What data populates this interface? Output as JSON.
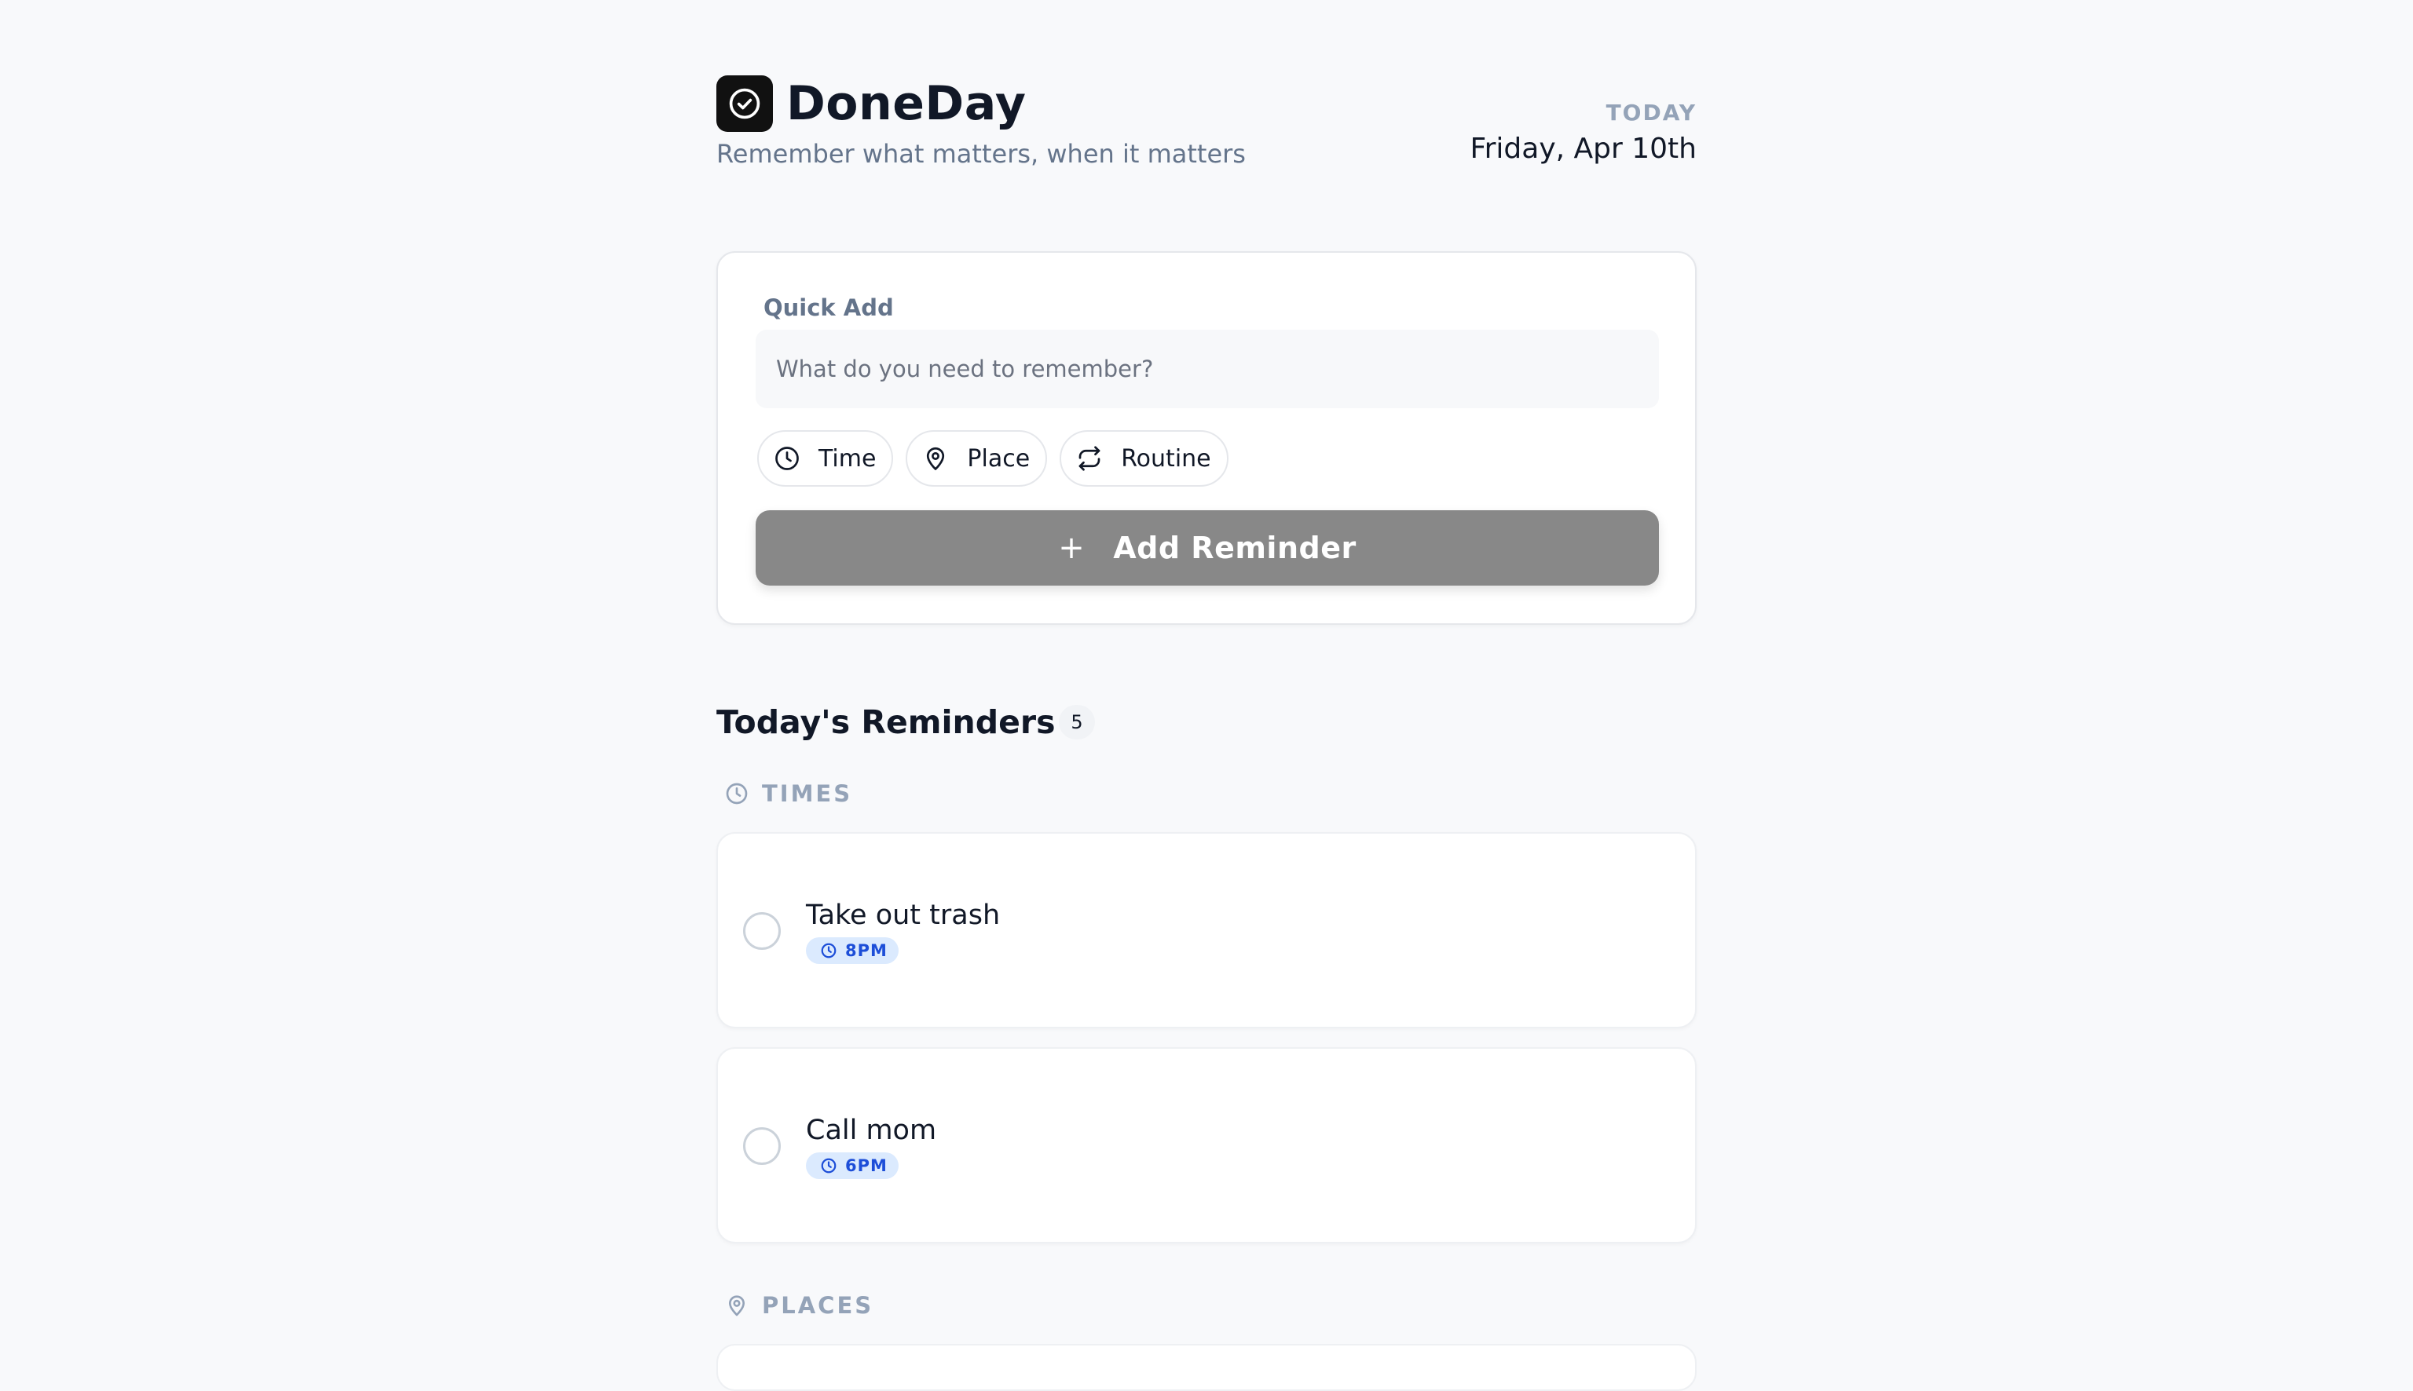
{
  "app": {
    "name": "DoneDay",
    "tagline": "Remember what matters, when it matters"
  },
  "today": {
    "label": "TODAY",
    "date": "Friday, Apr 10th"
  },
  "quick_add": {
    "label": "Quick Add",
    "placeholder": "What do you need to remember?",
    "chips": [
      {
        "label": "Time",
        "icon": "clock-icon"
      },
      {
        "label": "Place",
        "icon": "map-pin-icon"
      },
      {
        "label": "Routine",
        "icon": "repeat-icon"
      }
    ],
    "button_plus": "+",
    "button_label": "Add Reminder"
  },
  "reminders": {
    "title": "Today's Reminders",
    "count": "5",
    "groups": [
      {
        "label": "TIMES",
        "icon": "clock-icon",
        "items": [
          {
            "title": "Take out trash",
            "time": "8PM"
          },
          {
            "title": "Call mom",
            "time": "6PM"
          }
        ]
      },
      {
        "label": "PLACES",
        "icon": "map-pin-icon",
        "items": []
      }
    ]
  },
  "colors": {
    "background": "#f8f9fb",
    "logo": "#111111",
    "button": "#888888",
    "tag_bg": "#dbeafe",
    "tag_text": "#1d4ed8",
    "muted": "#94a3b8"
  }
}
